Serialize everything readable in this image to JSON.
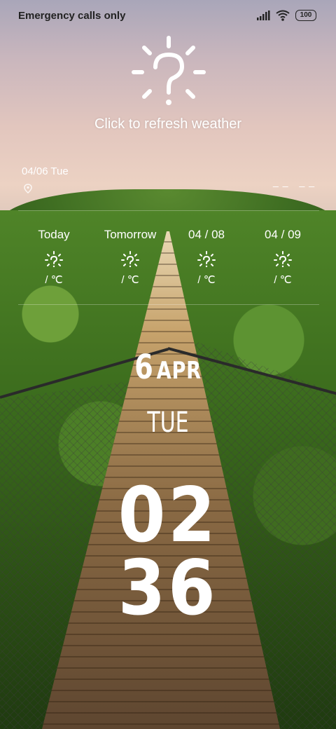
{
  "status_bar": {
    "carrier_text": "Emergency calls only",
    "battery_level": "100",
    "icons": [
      "signal-icon",
      "wifi-icon",
      "battery-icon"
    ]
  },
  "weather": {
    "refresh_text": "Click to refresh weather",
    "date_line": "04/06  Tue",
    "temp_range": "__ __",
    "forecast": [
      {
        "label": "Today",
        "temp": "/ ℃",
        "icon": "sun-unknown-icon"
      },
      {
        "label": "Tomorrow",
        "temp": "/ ℃",
        "icon": "sun-unknown-icon"
      },
      {
        "label": "04 / 08",
        "temp": "/ ℃",
        "icon": "sun-unknown-icon"
      },
      {
        "label": "04 / 09",
        "temp": "/ ℃",
        "icon": "sun-unknown-icon"
      }
    ]
  },
  "clock": {
    "day": "6",
    "month": "APR",
    "weekday": "TUE",
    "hour": "02",
    "minute": "36"
  },
  "colors": {
    "text": "#ffffff",
    "status_text": "#222222"
  }
}
